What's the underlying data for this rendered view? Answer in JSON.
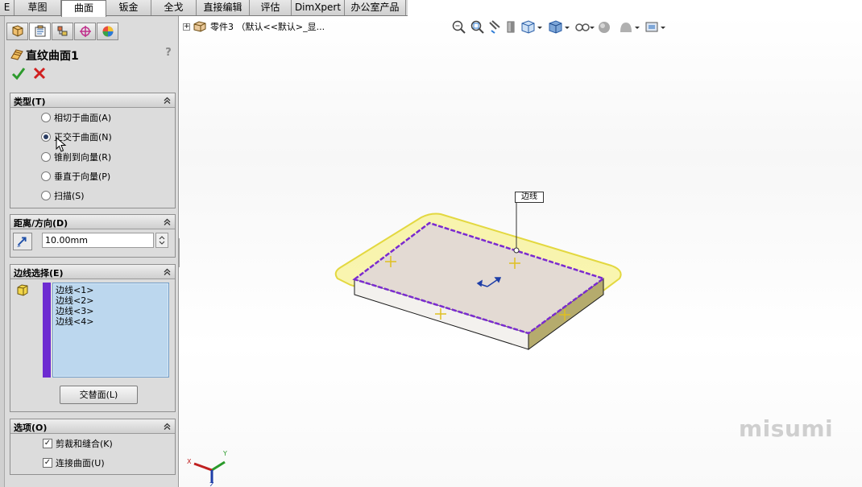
{
  "command_tabs": [
    {
      "label": "E",
      "active": false
    },
    {
      "label": "草图",
      "active": false
    },
    {
      "label": "曲面",
      "active": true
    },
    {
      "label": "钣金",
      "active": false
    },
    {
      "label": "全戈",
      "active": false
    },
    {
      "label": "直接编辑",
      "active": false
    },
    {
      "label": "评估",
      "active": false
    },
    {
      "label": "DimXpert",
      "active": false
    },
    {
      "label": "办公室产品",
      "active": false
    }
  ],
  "property_manager": {
    "tabs": [
      "feature-manager-icon",
      "property-manager-icon",
      "configuration-manager-icon",
      "dimxpert-manager-icon",
      "display-manager-icon"
    ],
    "title": "直纹曲面1",
    "help_label": "?",
    "type_group": {
      "title": "类型(T)",
      "options": [
        {
          "label": "相切于曲面(A)",
          "checked": false
        },
        {
          "label": "正交于曲面(N)",
          "checked": true
        },
        {
          "label": "锥削到向量(R)",
          "checked": false
        },
        {
          "label": "垂直于向量(P)",
          "checked": false
        },
        {
          "label": "扫描(S)",
          "checked": false
        }
      ]
    },
    "distance_group": {
      "title": "距离/方向(D)",
      "value": "10.00mm"
    },
    "edge_group": {
      "title": "边线选择(E)",
      "edges": [
        "边线<1>",
        "边线<2>",
        "边线<3>",
        "边线<4>"
      ],
      "alt_face_button": "交替面(L)"
    },
    "options_group": {
      "title": "选项(O)",
      "options": [
        {
          "label": "剪裁和缝合(K)",
          "checked": true
        },
        {
          "label": "连接曲面(U)",
          "checked": true
        }
      ]
    }
  },
  "viewport": {
    "tree_root": "零件3 （默认<<默认>_显...",
    "callout": "边线",
    "watermark": "misumi",
    "triad_labels": {
      "x": "X",
      "y": "Y",
      "z": "Z"
    }
  },
  "colors": {
    "selection_purple": "#6d2bd1",
    "preview_yellow": "#f3ea3a",
    "part_face": "#e3dad3"
  }
}
